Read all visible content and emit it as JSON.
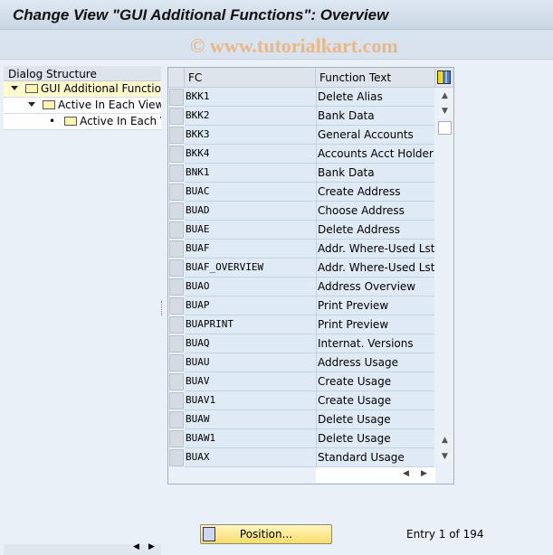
{
  "title": "Change View \"GUI Additional Functions\": Overview",
  "watermark": "© www.tutorialkart.com",
  "dialog_structure": {
    "header": "Dialog Structure",
    "nodes": [
      {
        "label": "GUI Additional Functions",
        "level": 0,
        "expanded": true,
        "selected": true
      },
      {
        "label": "Active In Each View",
        "level": 1,
        "expanded": true
      },
      {
        "label": "Active In Each View",
        "level": 2,
        "leaf": true
      }
    ]
  },
  "table": {
    "columns": [
      "FC",
      "Function Text"
    ],
    "rows": [
      [
        "BKK1",
        "Delete Alias"
      ],
      [
        "BKK2",
        "Bank Data"
      ],
      [
        "BKK3",
        "General Accounts"
      ],
      [
        "BKK4",
        "Accounts Acct Holder"
      ],
      [
        "BNK1",
        "Bank Data"
      ],
      [
        "BUAC",
        "Create Address"
      ],
      [
        "BUAD",
        "Choose Address"
      ],
      [
        "BUAE",
        "Delete Address"
      ],
      [
        "BUAF",
        "Addr. Where-Used Lst"
      ],
      [
        "BUAF_OVERVIEW",
        "Addr. Where-Used Lst"
      ],
      [
        "BUAO",
        "Address Overview"
      ],
      [
        "BUAP",
        "Print Preview"
      ],
      [
        "BUAPRINT",
        "Print Preview"
      ],
      [
        "BUAQ",
        "Internat. Versions"
      ],
      [
        "BUAU",
        "Address Usage"
      ],
      [
        "BUAV",
        "Create Usage"
      ],
      [
        "BUAV1",
        "Create Usage"
      ],
      [
        "BUAW",
        "Delete Usage"
      ],
      [
        "BUAW1",
        "Delete Usage"
      ],
      [
        "BUAX",
        "Standard Usage"
      ]
    ]
  },
  "position_button": "Position...",
  "entry_info": "Entry 1 of 194"
}
